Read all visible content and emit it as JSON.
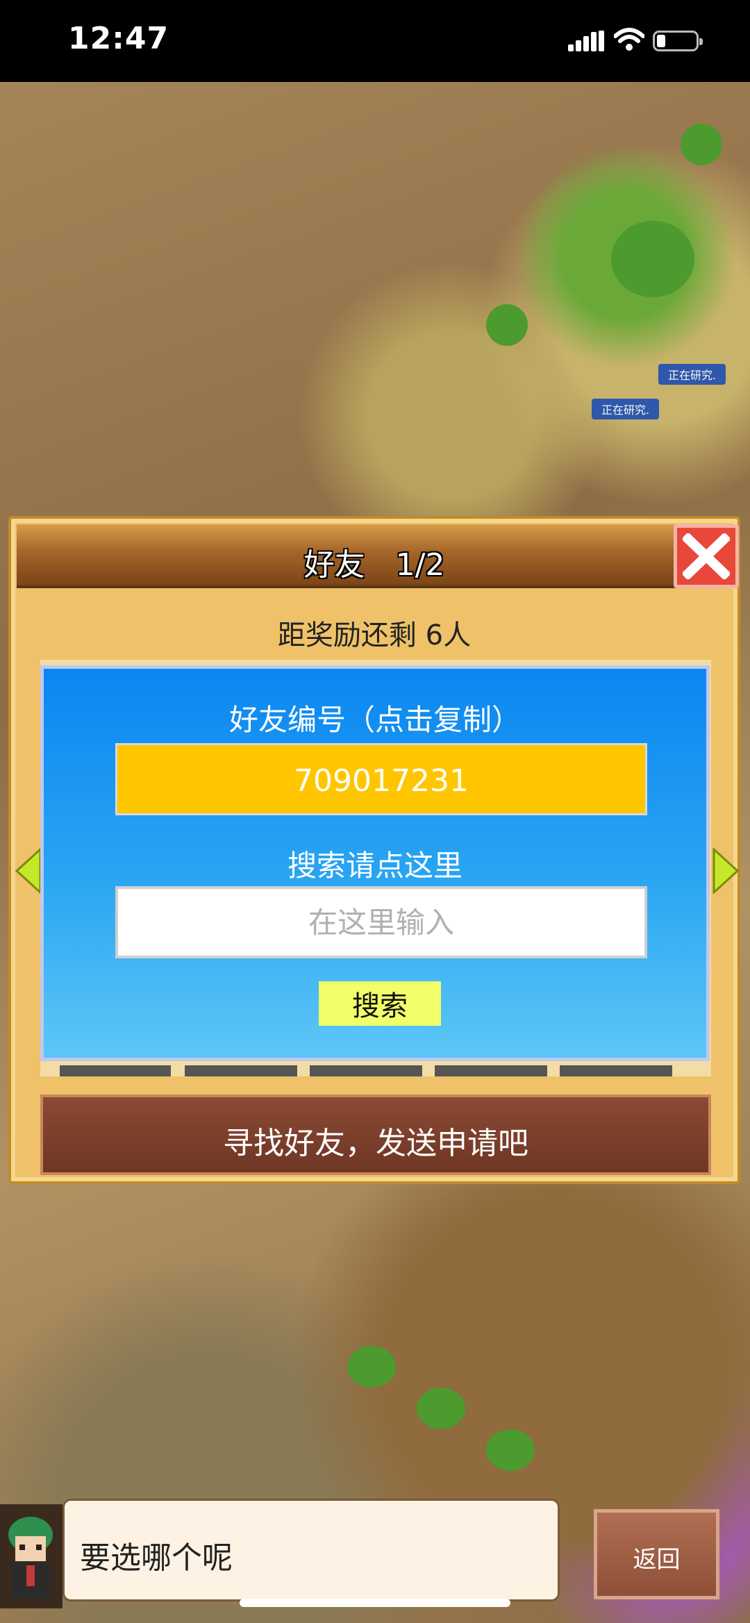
{
  "status_bar": {
    "time": "12:47"
  },
  "map": {
    "research_tags": [
      "正在研究.",
      "正在研究."
    ]
  },
  "panel": {
    "title": "好友　1/2",
    "reward_text": "距奖励还剩 6人",
    "dialog": {
      "friend_id_label": "好友编号（点击复制）",
      "friend_id": "709017231",
      "search_label": "搜索请点这里",
      "search_placeholder": "在这里输入",
      "search_button": "搜索"
    },
    "find_friends_button": "寻找好友，发送申请吧"
  },
  "bottom": {
    "speech": "要选哪个呢",
    "back_button": "返回"
  },
  "colors": {
    "dialog_blue": "#0a86f2",
    "id_box_yellow": "#ffc600",
    "search_button": "#f3ff6a",
    "close_red": "#e8483a"
  }
}
